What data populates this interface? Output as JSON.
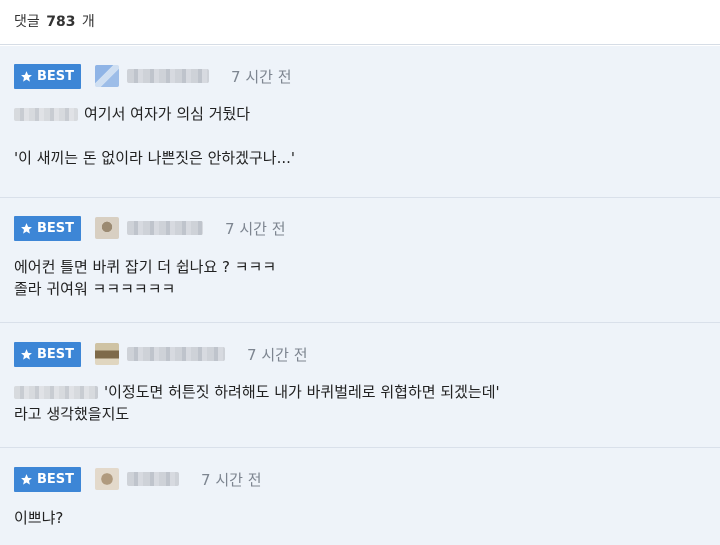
{
  "header": {
    "label": "댓글",
    "count": "783",
    "unit": "개"
  },
  "badge_label": "BEST",
  "comments": [
    {
      "time": "7 시간 전",
      "lines": [
        "여기서 여자가 의심 거뒀다",
        "",
        "'이 새끼는 돈 없이라 나쁜짓은 안하겠구나...'"
      ]
    },
    {
      "time": "7 시간 전",
      "lines": [
        "에어컨 틀면 바퀴 잡기 더 쉽나요 ? ㅋㅋㅋ",
        "졸라 귀여워 ㅋㅋㅋㅋㅋㅋ"
      ]
    },
    {
      "time": "7 시간 전",
      "lines": [
        "'이정도면 허튼짓 하려해도 내가 바퀴벌레로 위협하면 되겠는데'",
        "라고 생각했을지도"
      ]
    },
    {
      "time": "7 시간 전",
      "lines": [
        "이쁘냐?"
      ]
    }
  ],
  "colors": {
    "badge": "#3d86d6",
    "comment_bg": "#eef3f9",
    "time": "#7d8590"
  },
  "icons": {
    "badge": "star-icon"
  }
}
